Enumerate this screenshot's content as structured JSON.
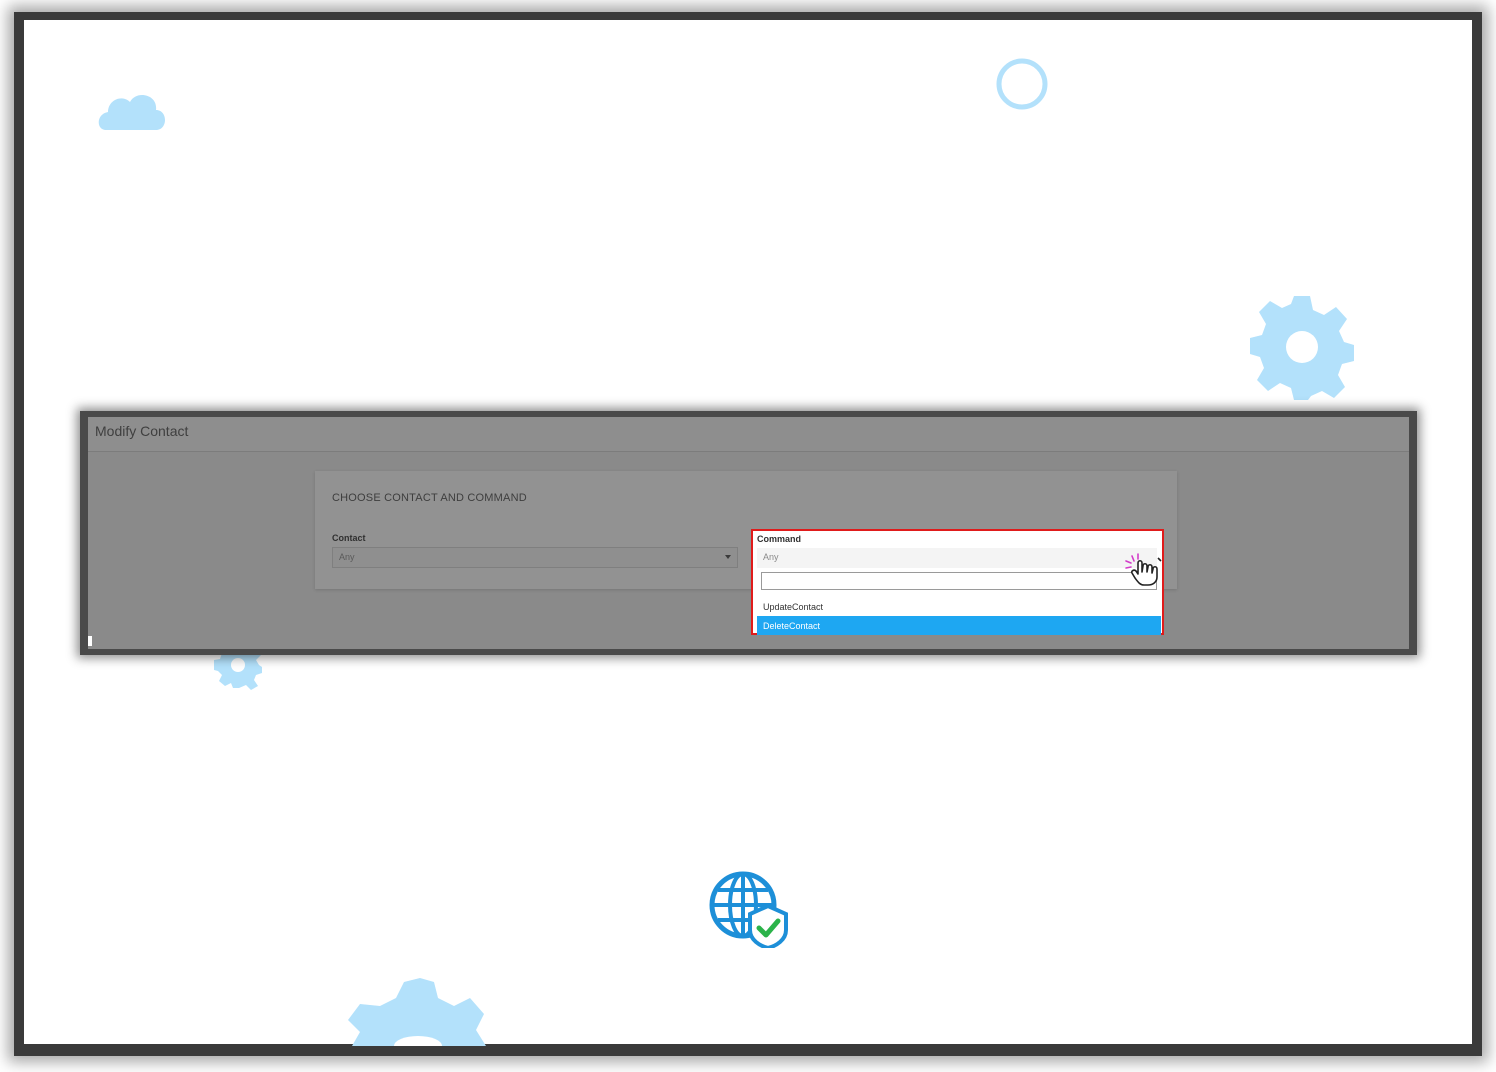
{
  "dialog": {
    "title": "Modify Contact",
    "section_title": "CHOOSE CONTACT AND COMMAND"
  },
  "contact_field": {
    "label": "Contact",
    "value": "Any"
  },
  "command_field": {
    "label": "Command",
    "value": "Any",
    "search_value": "",
    "options": [
      {
        "label": "UpdateContact",
        "selected": false
      },
      {
        "label": "DeleteContact",
        "selected": true
      }
    ]
  },
  "decorations": [
    "cloud-icon",
    "circle-icon",
    "gear-icon",
    "globe-shield-icon",
    "pointer-click-icon"
  ],
  "colors": {
    "accent": "#1ea7f2",
    "highlight_border": "#e01b1b",
    "deco_blue": "#b3e1fb"
  }
}
